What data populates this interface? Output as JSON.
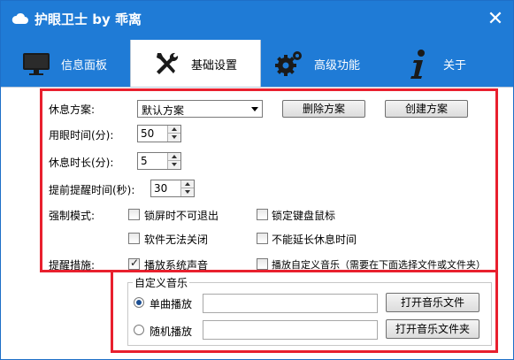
{
  "app": {
    "title": "护眼卫士 by 乖离",
    "close_symbol": "✕"
  },
  "tabs": [
    {
      "label": "信息面板",
      "icon": "monitor-icon",
      "active": false
    },
    {
      "label": "基础设置",
      "icon": "tools-icon",
      "active": true
    },
    {
      "label": "高级功能",
      "icon": "gears-icon",
      "active": false
    },
    {
      "label": "关于",
      "icon": "info-icon",
      "active": false
    }
  ],
  "settings": {
    "plan_label": "休息方案:",
    "plan_value": "默认方案",
    "delete_plan_button": "删除方案",
    "create_plan_button": "创建方案",
    "eye_time_label": "用眼时间(分):",
    "eye_time_value": "50",
    "rest_time_label": "休息时长(分):",
    "rest_time_value": "5",
    "advance_label": "提前提醒时间(秒):",
    "advance_value": "30",
    "force_mode_label": "强制模式:",
    "lock_no_exit": "锁屏时不可退出",
    "lock_keyboard_mouse": "锁定键盘鼠标",
    "cannot_close": "软件无法关闭",
    "cannot_extend": "不能延长休息时间",
    "remind_label": "提醒措施:",
    "play_system_sound": "播放系统声音",
    "play_custom_music": "播放自定义音乐（需要在下面选择文件或文件夹）",
    "checks": {
      "lock_no_exit": false,
      "lock_keyboard_mouse": false,
      "cannot_close": false,
      "cannot_extend": false,
      "play_system_sound": true,
      "play_custom_music": false
    }
  },
  "music": {
    "group_title": "自定义音乐",
    "single_label": "单曲播放",
    "random_label": "随机播放",
    "single_selected": true,
    "single_path": "",
    "random_path": "",
    "open_file_button": "打开音乐文件",
    "open_folder_button": "打开音乐文件夹"
  },
  "colors": {
    "title_bar": "#1f7bd6",
    "highlight_border": "#e8202e"
  }
}
